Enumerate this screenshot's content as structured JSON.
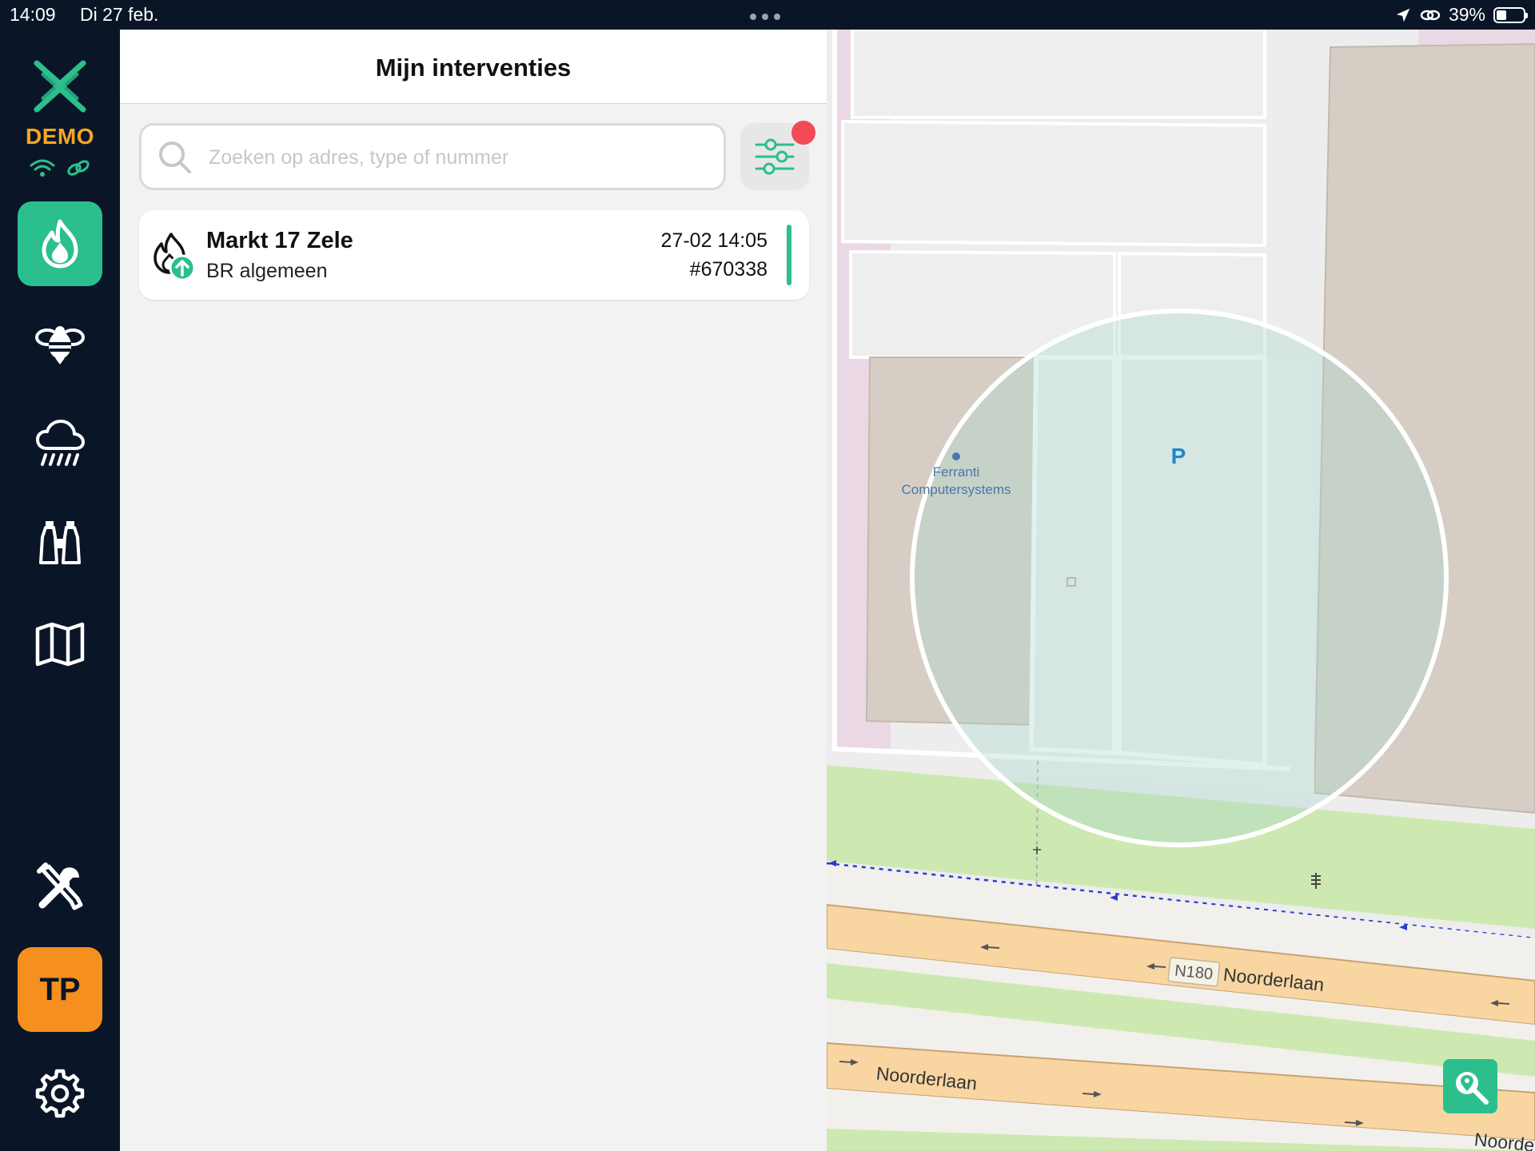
{
  "status": {
    "time": "14:09",
    "date": "Di 27 feb.",
    "battery": "39%",
    "battery_level": 0.39
  },
  "sidebar": {
    "badge": "DEMO",
    "items": [
      {
        "icon": "fire-icon",
        "active": true
      },
      {
        "icon": "bee-icon",
        "active": false
      },
      {
        "icon": "rain-icon",
        "active": false
      },
      {
        "icon": "binoculars-icon",
        "active": false
      },
      {
        "icon": "map-icon",
        "active": false
      },
      {
        "icon": "tools-icon",
        "active": false
      }
    ],
    "user_initials": "TP",
    "settings_icon": "gear-icon"
  },
  "panel": {
    "title": "Mijn interventies",
    "search_placeholder": "Zoeken op adres, type of nummer",
    "search_value": "",
    "interventions": [
      {
        "title": "Markt 17 Zele",
        "type": "BR algemeen",
        "datetime": "27-02 14:05",
        "number": "#670338"
      }
    ]
  },
  "map": {
    "poi_name_1": "Ferranti",
    "poi_name_2": "Computersystems",
    "parking": "P",
    "road_ref": "N180",
    "road_name": "Noorderlaan",
    "road_name_cut": "Noorde"
  },
  "colors": {
    "accent": "#2bbf8e",
    "demo": "#f5a623",
    "avatar": "#f5901e",
    "notification": "#f24b55",
    "sidebar_bg": "#0a1628"
  }
}
